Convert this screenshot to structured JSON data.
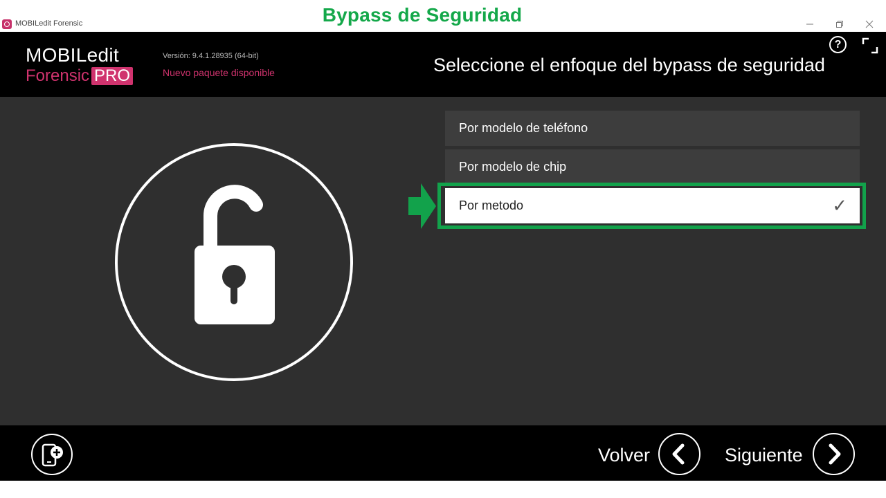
{
  "overlay": {
    "caption": "Bypass de Seguridad"
  },
  "window": {
    "title": "MOBILedit Forensic",
    "minimize_icon": "minimize-icon",
    "restore_icon": "restore-icon",
    "close_icon": "close-icon"
  },
  "header": {
    "logo_main": "MOBILedit",
    "logo_sub": "Forensic",
    "logo_pro": "PRO",
    "version": "Versión: 9.4.1.28935 (64-bit)",
    "new_package": "Nuevo paquete disponible",
    "title": "Seleccione el enfoque del bypass de seguridad",
    "help_label": "?"
  },
  "options": [
    {
      "label": "Por modelo de teléfono",
      "selected": false
    },
    {
      "label": "Por modelo de chip",
      "selected": false
    },
    {
      "label": "Por metodo",
      "selected": true
    }
  ],
  "selection": {
    "check": "✓"
  },
  "footer": {
    "back_label": "Volver",
    "next_label": "Siguiente"
  },
  "colors": {
    "accent": "#d0336e",
    "highlight": "#12a24b",
    "content_bg": "#2f2f2f",
    "header_bg": "#000000"
  }
}
